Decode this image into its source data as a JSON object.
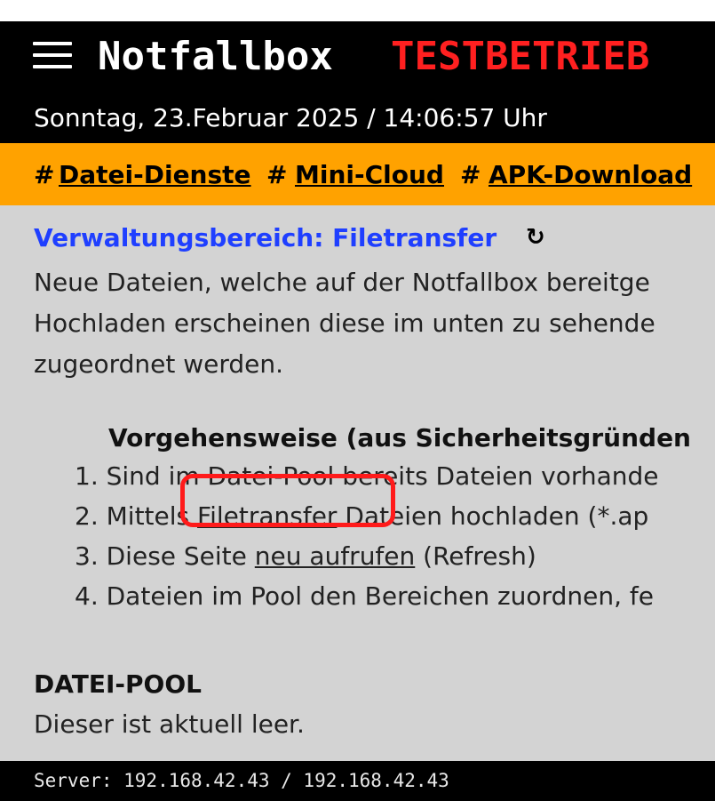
{
  "header": {
    "app_title": "Notfallbox",
    "mode_badge": "TESTBETRIEB",
    "datetime": "Sonntag, 23.Februar 2025 / 14:06:57 Uhr"
  },
  "nav": {
    "separator": "#",
    "items": [
      "Datei-Dienste",
      "Mini-Cloud",
      "APK-Download"
    ]
  },
  "content": {
    "section_title": "Verwaltungsbereich: Filetransfer",
    "description_lines": [
      "Neue Dateien, welche auf der Notfallbox bereitge",
      "Hochladen erscheinen diese im unten zu sehende",
      "zugeordnet werden."
    ],
    "procedure_title": "Vorgehensweise (aus Sicherheitsgründen",
    "steps": [
      {
        "num": "1.",
        "before": "Sind im Datei-Pool bereits Dateien vorhande",
        "link": "",
        "after": ""
      },
      {
        "num": "2.",
        "before": "Mittels ",
        "link": "Filetransfer",
        "after": " Dateien hochladen (*.ap"
      },
      {
        "num": "3.",
        "before": "Diese Seite ",
        "link": "neu aufrufen",
        "after": " (Refresh)"
      },
      {
        "num": "4.",
        "before": "Dateien im Pool den Bereichen zuordnen, fe",
        "link": "",
        "after": ""
      }
    ],
    "pool_title": "DATEI-POOL",
    "pool_status": "Dieser ist aktuell leer."
  },
  "footer": {
    "server_info": "Server: 192.168.42.43 / 192.168.42.43"
  },
  "colors": {
    "accent_nav": "#ffa200",
    "mode_badge": "#ff2020",
    "section_title": "#1f3fff",
    "highlight": "#ff1a1a"
  }
}
